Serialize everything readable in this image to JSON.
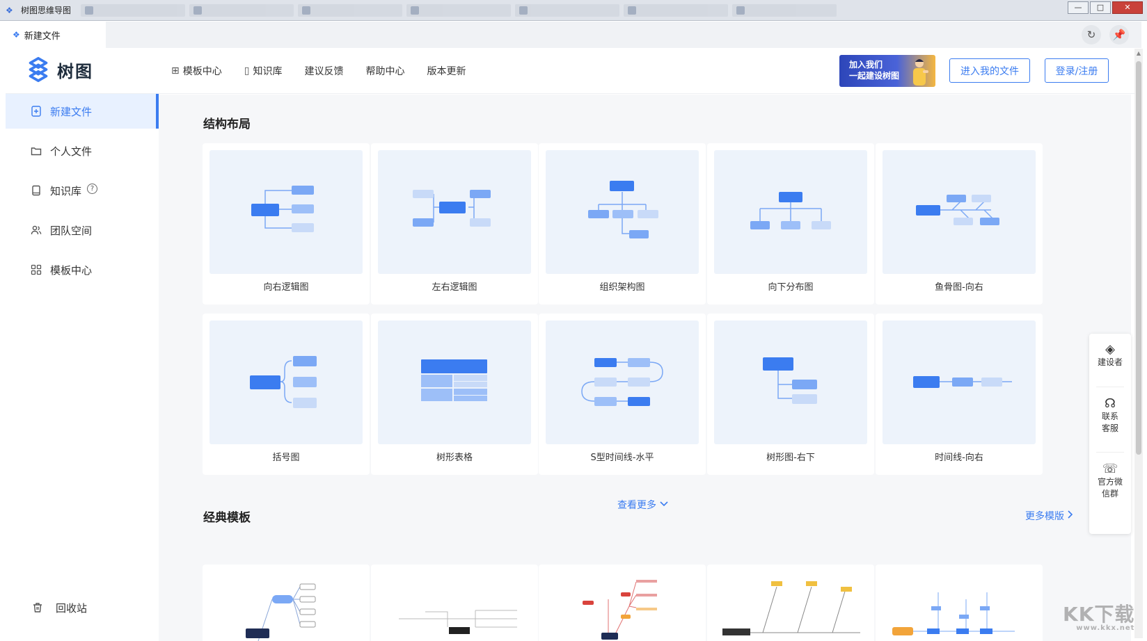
{
  "os_window": {
    "title": "树图思维导图",
    "controls": {
      "minimize": "—",
      "maximize": "□",
      "close": "✕"
    }
  },
  "app_tab": {
    "label": "新建文件"
  },
  "header": {
    "logo_text": "树图",
    "nav": [
      {
        "label": "模板中心",
        "icon": "grid-icon"
      },
      {
        "label": "知识库",
        "icon": "book-icon"
      },
      {
        "label": "建议反馈"
      },
      {
        "label": "帮助中心"
      },
      {
        "label": "版本更新"
      }
    ],
    "promo_line1": "加入我们",
    "promo_line2": "一起建设树图",
    "btn_my_files": "进入我的文件",
    "btn_login": "登录/注册"
  },
  "sidebar": {
    "items": [
      {
        "label": "新建文件",
        "icon": "plus-file-icon",
        "active": true
      },
      {
        "label": "个人文件",
        "icon": "folder-icon"
      },
      {
        "label": "知识库",
        "icon": "book-icon",
        "help": "?"
      },
      {
        "label": "团队空间",
        "icon": "team-icon"
      },
      {
        "label": "模板中心",
        "icon": "grid-icon"
      }
    ],
    "recycle": "回收站"
  },
  "main": {
    "structure_title": "结构布局",
    "layouts": [
      "向右逻辑图",
      "左右逻辑图",
      "组织架构图",
      "向下分布图",
      "鱼骨图-向右",
      "括号图",
      "树形表格",
      "S型时间线-水平",
      "树形图-右下",
      "时间线-向右"
    ],
    "see_more": "查看更多",
    "classic_title": "经典模板",
    "more_templates": "更多模版"
  },
  "float_panel": {
    "items": [
      {
        "label": "建设者",
        "icon": "builder-icon"
      },
      {
        "label": "联系客服",
        "icon": "headset-icon"
      },
      {
        "label": "官方微信群",
        "icon": "wechat-icon"
      }
    ]
  },
  "watermark": {
    "text": "KK下载",
    "sub": "www.kkx.net"
  },
  "colors": {
    "accent": "#3b7cf0",
    "node_dark": "#3b7cf0",
    "node_mid": "#7ba8f5",
    "node_light": "#c8daf8",
    "thumb_bg": "#edf3fb"
  }
}
